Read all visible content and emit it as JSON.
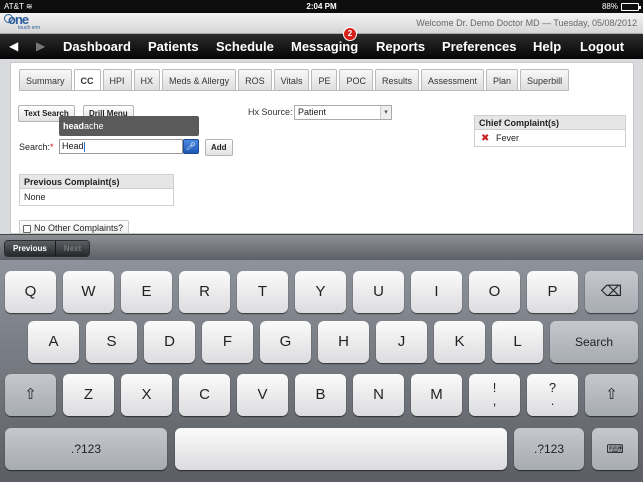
{
  "status_bar": {
    "carrier": "AT&T",
    "time": "2:04 PM",
    "battery": "88%",
    "battery_level": 0.88
  },
  "header": {
    "logo_text": "one",
    "logo_subtext": "touch emr",
    "welcome": "Welcome Dr. Demo Doctor MD — Tuesday, 05/08/2012"
  },
  "nav": {
    "items": [
      "Dashboard",
      "Patients",
      "Schedule",
      "Messaging",
      "Reports",
      "Preferences",
      "Help",
      "Logout"
    ],
    "messaging_badge": "2"
  },
  "tabs": [
    "Summary",
    "CC",
    "HPI",
    "HX",
    "Meds & Allergy",
    "ROS",
    "Vitals",
    "PE",
    "POC",
    "Results",
    "Assessment",
    "Plan",
    "Superbill"
  ],
  "active_tab": "CC",
  "cc_form": {
    "text_search_label": "Text Search",
    "drill_menu_label": "Drill Menu",
    "hx_source_label": "Hx Source:",
    "hx_source_value": "Patient",
    "search_label": "Search:",
    "search_required_mark": "*",
    "search_value": "Head",
    "add_label": "Add",
    "suggestion_match": "head",
    "suggestion_rest": "ache",
    "chief_complaints_title": "Chief Complaint(s)",
    "chief_complaints": [
      "Fever"
    ],
    "previous_complaints_title": "Previous Complaint(s)",
    "previous_complaints_value": "None",
    "no_other_label": "No Other Complaints?"
  },
  "accessory": {
    "previous_label": "Previous",
    "next_label": "Next"
  },
  "keyboard": {
    "row1": [
      "Q",
      "W",
      "E",
      "R",
      "T",
      "Y",
      "U",
      "I",
      "O",
      "P"
    ],
    "row2": [
      "A",
      "S",
      "D",
      "F",
      "G",
      "H",
      "J",
      "K",
      "L"
    ],
    "row3": [
      "Z",
      "X",
      "C",
      "V",
      "B",
      "N",
      "M"
    ],
    "search_label": "Search",
    "numbers_label": ".?123",
    "exclaim_top": "!",
    "exclaim_bottom": ",",
    "question_top": "?",
    "question_bottom": "."
  }
}
